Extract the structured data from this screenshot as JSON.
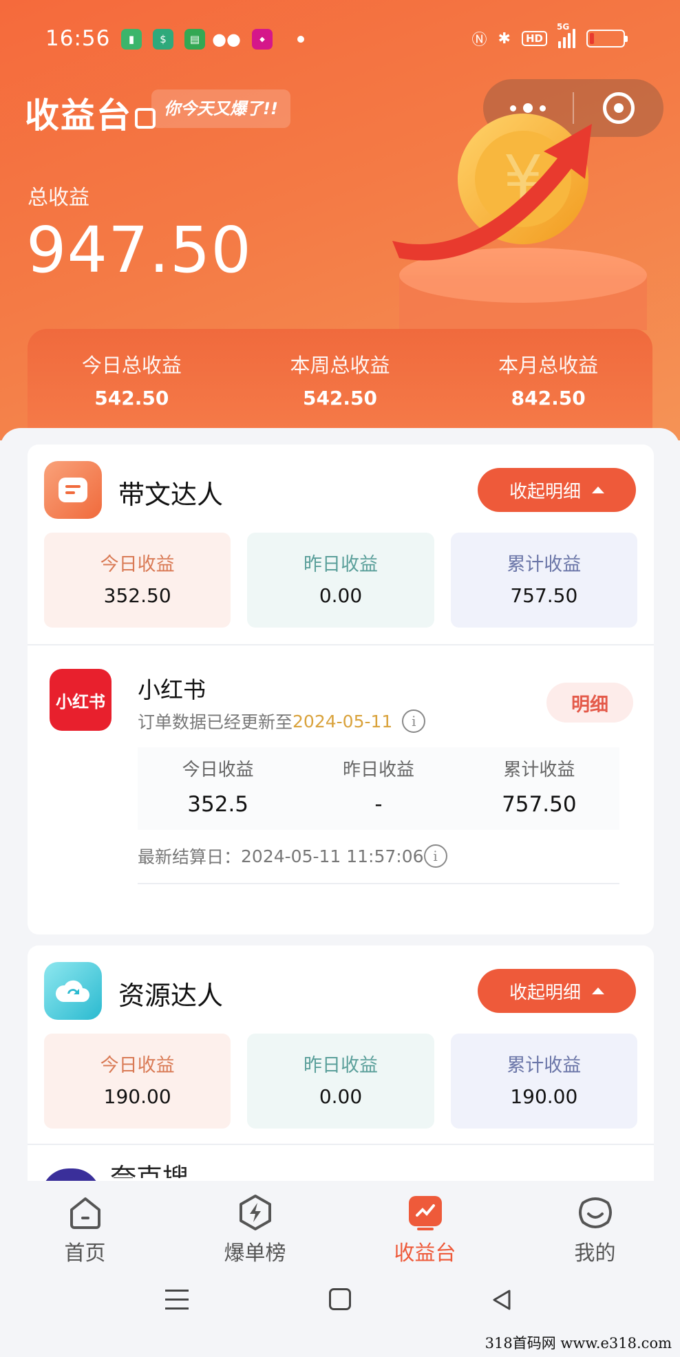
{
  "status_bar": {
    "time": "16:56",
    "network_label": "5G",
    "hd_label": "HD",
    "battery_level": 0.12
  },
  "header": {
    "title": "收益台",
    "slogan": "你今天又爆了!!"
  },
  "totals": {
    "label": "总收益",
    "value": "947.50"
  },
  "summary": [
    {
      "label": "今日总收益",
      "value": "542.50"
    },
    {
      "label": "本周总收益",
      "value": "542.50"
    },
    {
      "label": "本月总收益",
      "value": "842.50"
    }
  ],
  "card_daiwen": {
    "title": "带文达人",
    "collapse_label": "收起明细",
    "stats": [
      {
        "label": "今日收益",
        "value": "352.50"
      },
      {
        "label": "昨日收益",
        "value": "0.00"
      },
      {
        "label": "累计收益",
        "value": "757.50"
      }
    ],
    "platform": {
      "logo_text": "小红书",
      "name": "小红书",
      "update_prefix": "订单数据已经更新至",
      "update_date": "2024-05-11",
      "detail_label": "明细",
      "stats": [
        {
          "label": "今日收益",
          "value": "352.5"
        },
        {
          "label": "昨日收益",
          "value": "-"
        },
        {
          "label": "累计收益",
          "value": "757.50"
        }
      ],
      "settle_label": "最新结算日：",
      "settle_value": "2024-05-11 11:57:06"
    }
  },
  "card_ziyuan": {
    "title": "资源达人",
    "collapse_label": "收起明细",
    "stats": [
      {
        "label": "今日收益",
        "value": "190.00"
      },
      {
        "label": "昨日收益",
        "value": "0.00"
      },
      {
        "label": "累计收益",
        "value": "190.00"
      }
    ],
    "next_item_partial": "夸克搜索"
  },
  "tabbar": [
    {
      "label": "首页",
      "icon": "home-icon",
      "active": false
    },
    {
      "label": "爆单榜",
      "icon": "lightning-icon",
      "active": false
    },
    {
      "label": "收益台",
      "icon": "earnings-icon",
      "active": true
    },
    {
      "label": "我的",
      "icon": "profile-icon",
      "active": false
    }
  ],
  "watermark": "318首码网  www.e318.com",
  "colors": {
    "accent": "#ee5a3a",
    "hero_gradient_start": "#f56a3c",
    "hero_gradient_end": "#f59356",
    "xiaohongshu_red": "#e8202d",
    "date_highlight": "#d9a23b"
  }
}
